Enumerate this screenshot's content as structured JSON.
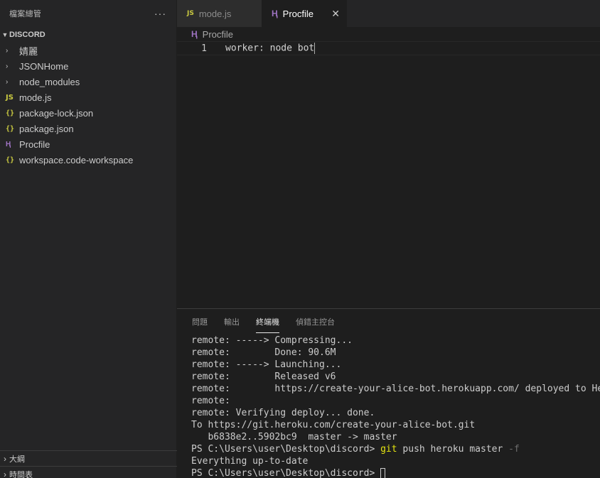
{
  "sidebar": {
    "title": "檔案總管",
    "more": "···",
    "root": "DISCORD",
    "items": [
      {
        "label": "婧麗",
        "type": "folder"
      },
      {
        "label": "JSONHome",
        "type": "folder"
      },
      {
        "label": "node_modules",
        "type": "folder"
      },
      {
        "label": "mode.js",
        "type": "js",
        "icon_text": "JS"
      },
      {
        "label": "package-lock.json",
        "type": "json",
        "icon_text": "{}"
      },
      {
        "label": "package.json",
        "type": "json",
        "icon_text": "{}"
      },
      {
        "label": "Procfile",
        "type": "heroku",
        "icon_text": "Ⱨ"
      },
      {
        "label": "workspace.code-workspace",
        "type": "json",
        "icon_text": "{}"
      }
    ],
    "outline": "大綱",
    "timeline": "時間表"
  },
  "tabs": [
    {
      "label": "mode.js",
      "icon_text": "JS",
      "active": false
    },
    {
      "label": "Procfile",
      "icon_text": "Ⱨ",
      "active": true,
      "close": "✕"
    }
  ],
  "editor": {
    "breadcrumb": "Procfile",
    "breadcrumb_icon": "Ⱨ",
    "line_number": "1",
    "code": "worker: node bot"
  },
  "panel": {
    "tabs": [
      "問題",
      "輸出",
      "終端機",
      "偵錯主控台"
    ],
    "active_tab": "終端機",
    "terminal": {
      "lines": [
        "remote: -----> Compressing...",
        "remote:        Done: 90.6M",
        "remote: -----> Launching...",
        "remote:        Released v6",
        "remote:        https://create-your-alice-bot.herokuapp.com/ deployed to Heroku",
        "remote:",
        "remote: Verifying deploy... done.",
        "To https://git.heroku.com/create-your-alice-bot.git",
        "   b6838e2..5902bc9  master -> master"
      ],
      "prompt": "PS C:\\Users\\user\\Desktop\\discord> ",
      "command_git": "git",
      "command_rest": " push heroku master ",
      "command_flag": "-f",
      "result": "Everything up-to-date",
      "final_prompt": "PS C:\\Users\\user\\Desktop\\discord> "
    }
  },
  "colors": {
    "accent_js": "#cbcb41",
    "accent_heroku": "#a074c4",
    "git_highlight": "#e5e510"
  }
}
